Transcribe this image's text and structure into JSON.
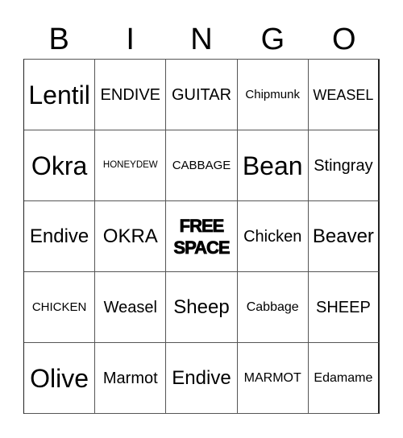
{
  "card": {
    "header_letters": [
      "B",
      "I",
      "N",
      "G",
      "O"
    ],
    "rows": [
      [
        "Lentil",
        "ENDIVE",
        "GUITAR",
        "Chipmunk",
        "WEASEL"
      ],
      [
        "Okra",
        "HONEYDEW",
        "CABBAGE",
        "Bean",
        "Stingray"
      ],
      [
        "Endive",
        "OKRA",
        "FREE SPACE",
        "Chicken",
        "Beaver"
      ],
      [
        "CHICKEN",
        "Weasel",
        "Sheep",
        "Cabbage",
        "SHEEP"
      ],
      [
        "Olive",
        "Marmot",
        "Endive",
        "MARMOT",
        "Edamame"
      ]
    ],
    "free_space": {
      "line1": "FREE",
      "line2": "SPACE"
    }
  }
}
